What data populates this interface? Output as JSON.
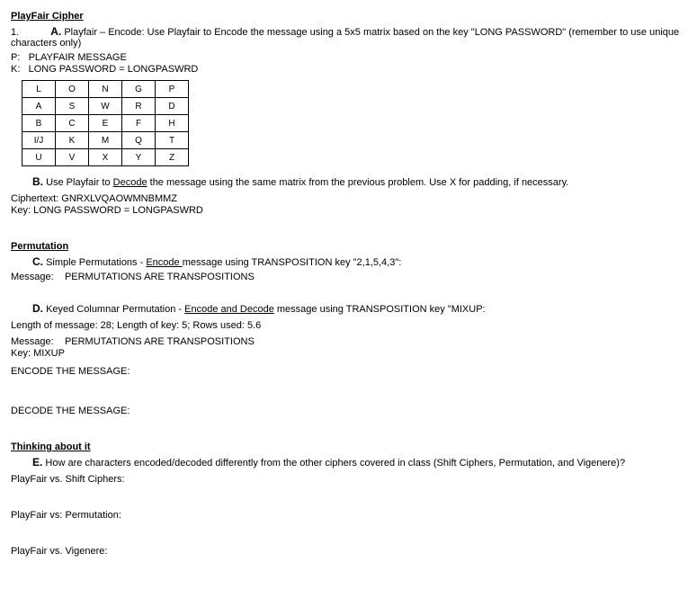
{
  "sections": {
    "playfair_title": "PlayFair Cipher",
    "permutation_title": "Permutation",
    "thinking_title": "Thinking about it"
  },
  "q1": {
    "num": "1.",
    "label": "A.",
    "desc_prefix": "Playfair – Encode: Use Playfair to Encode the message using a 5x5 matrix based on the key \"LONG PASSWORD\" (remember to use unique characters only)",
    "p_label": "P:",
    "p_value": "PLAYFAIR MESSAGE",
    "k_label": "K:",
    "k_value": "LONG PASSWORD = LONGPASWRD",
    "matrix": [
      [
        "L",
        "O",
        "N",
        "G",
        "P"
      ],
      [
        "A",
        "S",
        "W",
        "R",
        "D"
      ],
      [
        "B",
        "C",
        "E",
        "F",
        "H"
      ],
      [
        "I/J",
        "K",
        "M",
        "Q",
        "T"
      ],
      [
        "U",
        "V",
        "X",
        "Y",
        "Z"
      ]
    ]
  },
  "qB": {
    "label": "B.",
    "desc1": "Use Playfair to ",
    "desc_u": "Decode",
    "desc2": " the message using the same matrix from the previous problem. Use X for padding, if necessary.",
    "ct_label": "Ciphertext:",
    "ct_value": "GNRXLVQAOWMNBMMZ",
    "key_label": "Key:",
    "key_value": "LONG PASSWORD = LONGPASWRD"
  },
  "qC": {
    "label": "C.",
    "desc1": "Simple Permutations - ",
    "desc_u": "Encode ",
    "desc2": "message using TRANSPOSITION key \"2,1,5,4,3\":",
    "msg_label": "Message:",
    "msg_value": "PERMUTATIONS ARE TRANSPOSITIONS"
  },
  "qD": {
    "label": "D.",
    "desc1": "Keyed Columnar Permutation - ",
    "desc_u": "Encode and Decode",
    "desc2": " message using TRANSPOSITION key \"MIXUP:",
    "len_line": "Length of message: 28; Length of key: 5; Rows used: 5.6",
    "msg_label": "Message:",
    "msg_value": "PERMUTATIONS ARE TRANSPOSITIONS",
    "key_label": "Key:",
    "key_value": "MIXUP",
    "encode_prompt": "ENCODE THE MESSAGE:",
    "decode_prompt": "DECODE THE MESSAGE:"
  },
  "qE": {
    "label": "E.",
    "desc": "How are characters encoded/decoded differently from the other ciphers covered in class (Shift Ciphers, Permutation, and Vigenere)?",
    "line1": "PlayFair vs. Shift Ciphers:",
    "line2": "PlayFair vs: Permutation:",
    "line3": "PlayFair vs. Vigenere:"
  }
}
